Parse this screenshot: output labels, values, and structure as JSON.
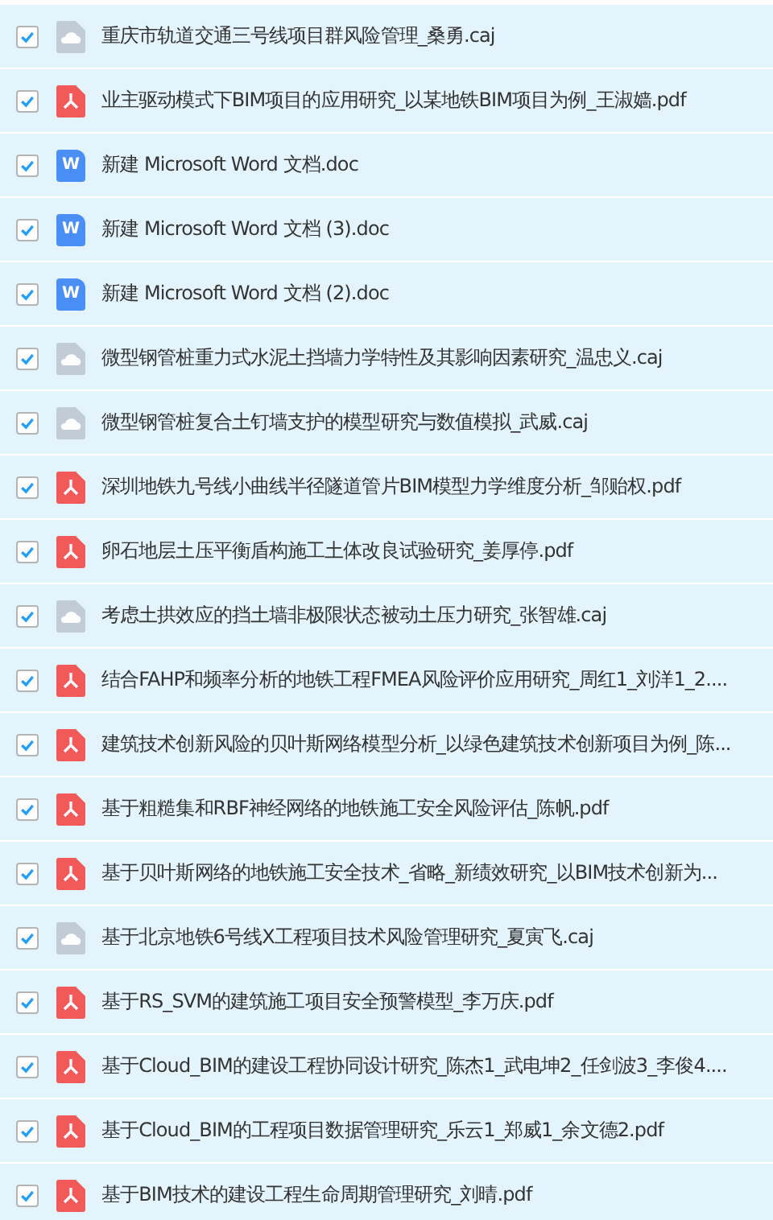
{
  "files": [
    {
      "kind": "caj",
      "name": "重庆市轨道交通三号线项目群风险管理_桑勇.caj",
      "checked": true
    },
    {
      "kind": "pdf",
      "name": "业主驱动模式下BIM项目的应用研究_以某地铁BIM项目为例_王淑嫱.pdf",
      "checked": true
    },
    {
      "kind": "doc",
      "badge": "W",
      "name": "新建 Microsoft Word 文档.doc",
      "checked": true
    },
    {
      "kind": "doc",
      "badge": "W",
      "name": "新建 Microsoft Word 文档 (3).doc",
      "checked": true
    },
    {
      "kind": "doc",
      "badge": "W",
      "name": "新建 Microsoft Word 文档 (2).doc",
      "checked": true
    },
    {
      "kind": "caj",
      "name": "微型钢管桩重力式水泥土挡墙力学特性及其影响因素研究_温忠义.caj",
      "checked": true
    },
    {
      "kind": "caj",
      "name": "微型钢管桩复合土钉墙支护的模型研究与数值模拟_武威.caj",
      "checked": true
    },
    {
      "kind": "pdf",
      "name": "深圳地铁九号线小曲线半径隧道管片BIM模型力学维度分析_邹贻权.pdf",
      "checked": true
    },
    {
      "kind": "pdf",
      "name": "卵石地层土压平衡盾构施工土体改良试验研究_姜厚停.pdf",
      "checked": true
    },
    {
      "kind": "caj",
      "name": "考虑土拱效应的挡土墙非极限状态被动土压力研究_张智雄.caj",
      "checked": true
    },
    {
      "kind": "pdf",
      "name": "结合FAHP和频率分析的地铁工程FMEA风险评价应用研究_周红1_刘洋1_2....",
      "checked": true
    },
    {
      "kind": "pdf",
      "name": "建筑技术创新风险的贝叶斯网络模型分析_以绿色建筑技术创新项目为例_陈...",
      "checked": true
    },
    {
      "kind": "pdf",
      "name": "基于粗糙集和RBF神经网络的地铁施工安全风险评估_陈帆.pdf",
      "checked": true
    },
    {
      "kind": "pdf",
      "name": "基于贝叶斯网络的地铁施工安全技术_省略_新绩效研究_以BIM技术创新为...",
      "checked": true
    },
    {
      "kind": "caj",
      "name": "基于北京地铁6号线X工程项目技术风险管理研究_夏寅飞.caj",
      "checked": true
    },
    {
      "kind": "pdf",
      "name": "基于RS_SVM的建筑施工项目安全预警模型_李万庆.pdf",
      "checked": true
    },
    {
      "kind": "pdf",
      "name": "基于Cloud_BIM的建设工程协同设计研究_陈杰1_武电坤2_任剑波3_李俊4....",
      "checked": true
    },
    {
      "kind": "pdf",
      "name": "基于Cloud_BIM的工程项目数据管理研究_乐云1_郑威1_余文德2.pdf",
      "checked": true
    },
    {
      "kind": "pdf",
      "name": "基于BIM技术的建设工程生命周期管理研究_刘晴.pdf",
      "checked": true
    }
  ]
}
